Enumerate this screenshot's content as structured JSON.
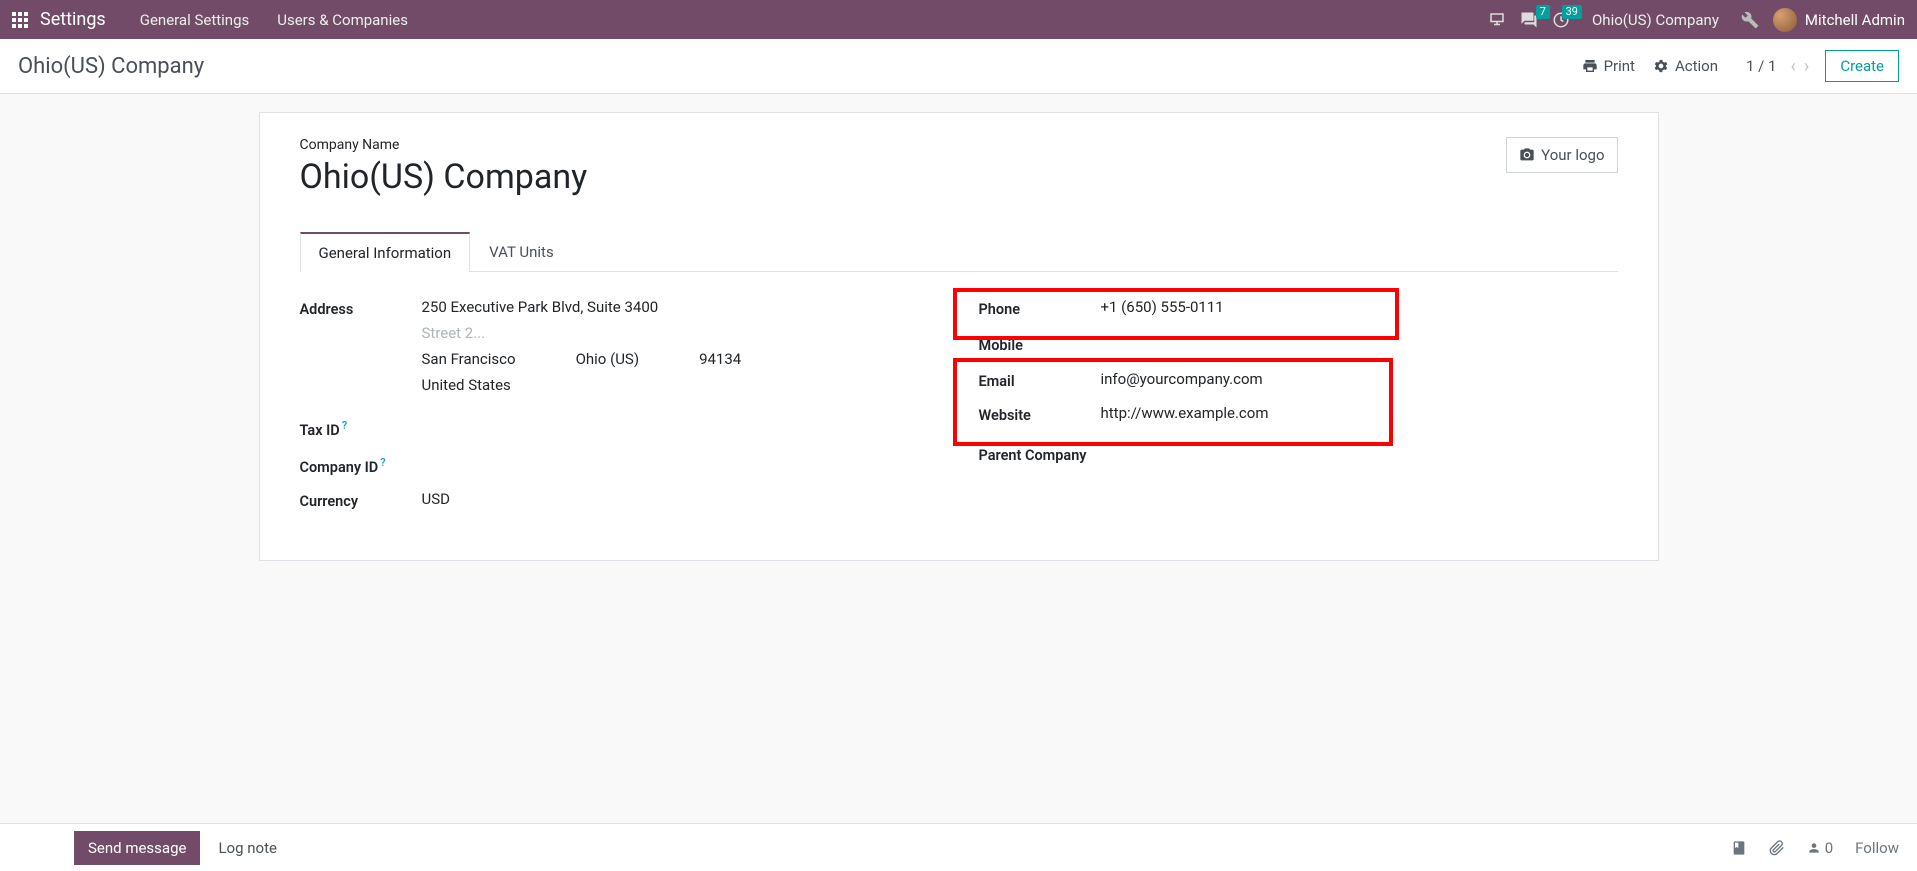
{
  "topbar": {
    "brand": "Settings",
    "menu": [
      "General Settings",
      "Users & Companies"
    ],
    "messages_badge": "7",
    "activities_badge": "39",
    "company": "Ohio(US) Company",
    "user": "Mitchell Admin"
  },
  "controlbar": {
    "title": "Ohio(US) Company",
    "print": "Print",
    "action": "Action",
    "pager": "1 / 1",
    "create": "Create"
  },
  "form": {
    "company_label": "Company Name",
    "company_name": "Ohio(US) Company",
    "logo_text": "Your logo",
    "tabs": {
      "general": "General Information",
      "vat": "VAT Units"
    },
    "labels": {
      "address": "Address",
      "tax_id": "Tax ID",
      "company_id": "Company ID",
      "currency": "Currency",
      "phone": "Phone",
      "mobile": "Mobile",
      "email": "Email",
      "website": "Website",
      "parent": "Parent Company"
    },
    "address": {
      "street": "250 Executive Park Blvd, Suite 3400",
      "street2_placeholder": "Street 2...",
      "city": "San Francisco",
      "state": "Ohio (US)",
      "zip": "94134",
      "country": "United States"
    },
    "currency": "USD",
    "phone": "+1 (650) 555-0111",
    "email": "info@yourcompany.com",
    "website": "http://www.example.com"
  },
  "chatter": {
    "send": "Send message",
    "log": "Log note",
    "followers": "0",
    "follow": "Follow"
  }
}
